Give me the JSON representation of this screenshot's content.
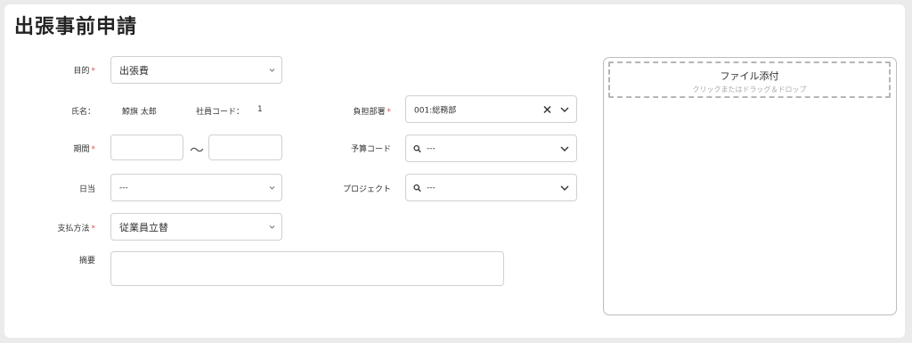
{
  "page": {
    "title": "出張事前申請"
  },
  "form": {
    "purpose": {
      "label": "目的",
      "required_mark": "*",
      "value": "出張費"
    },
    "name": {
      "label": "氏名：",
      "value": "鯨旗 太郎"
    },
    "employee_code": {
      "label": "社員コード：",
      "value": "1"
    },
    "department": {
      "label": "負担部署",
      "required_mark": "*",
      "value": "001:総務部"
    },
    "period": {
      "label": "期間",
      "required_mark": "*",
      "separator": "〜",
      "start": "",
      "end": ""
    },
    "budget_code": {
      "label": "予算コード",
      "value": "---"
    },
    "daily_allowance": {
      "label": "日当",
      "value": "---"
    },
    "project": {
      "label": "プロジェクト",
      "value": "---"
    },
    "payment_method": {
      "label": "支払方法",
      "required_mark": "*",
      "value": "従業員立替"
    },
    "summary": {
      "label": "摘要",
      "value": ""
    }
  },
  "attachment": {
    "title": "ファイル添付",
    "hint": "クリックまたはドラッグ＆ドロップ"
  },
  "icons": {
    "caret": "chevron-down-icon",
    "clear": "close-icon",
    "search": "search-icon"
  },
  "colors": {
    "required": "#d9534f",
    "border": "#d0d0d0",
    "background": "#ebebeb"
  }
}
